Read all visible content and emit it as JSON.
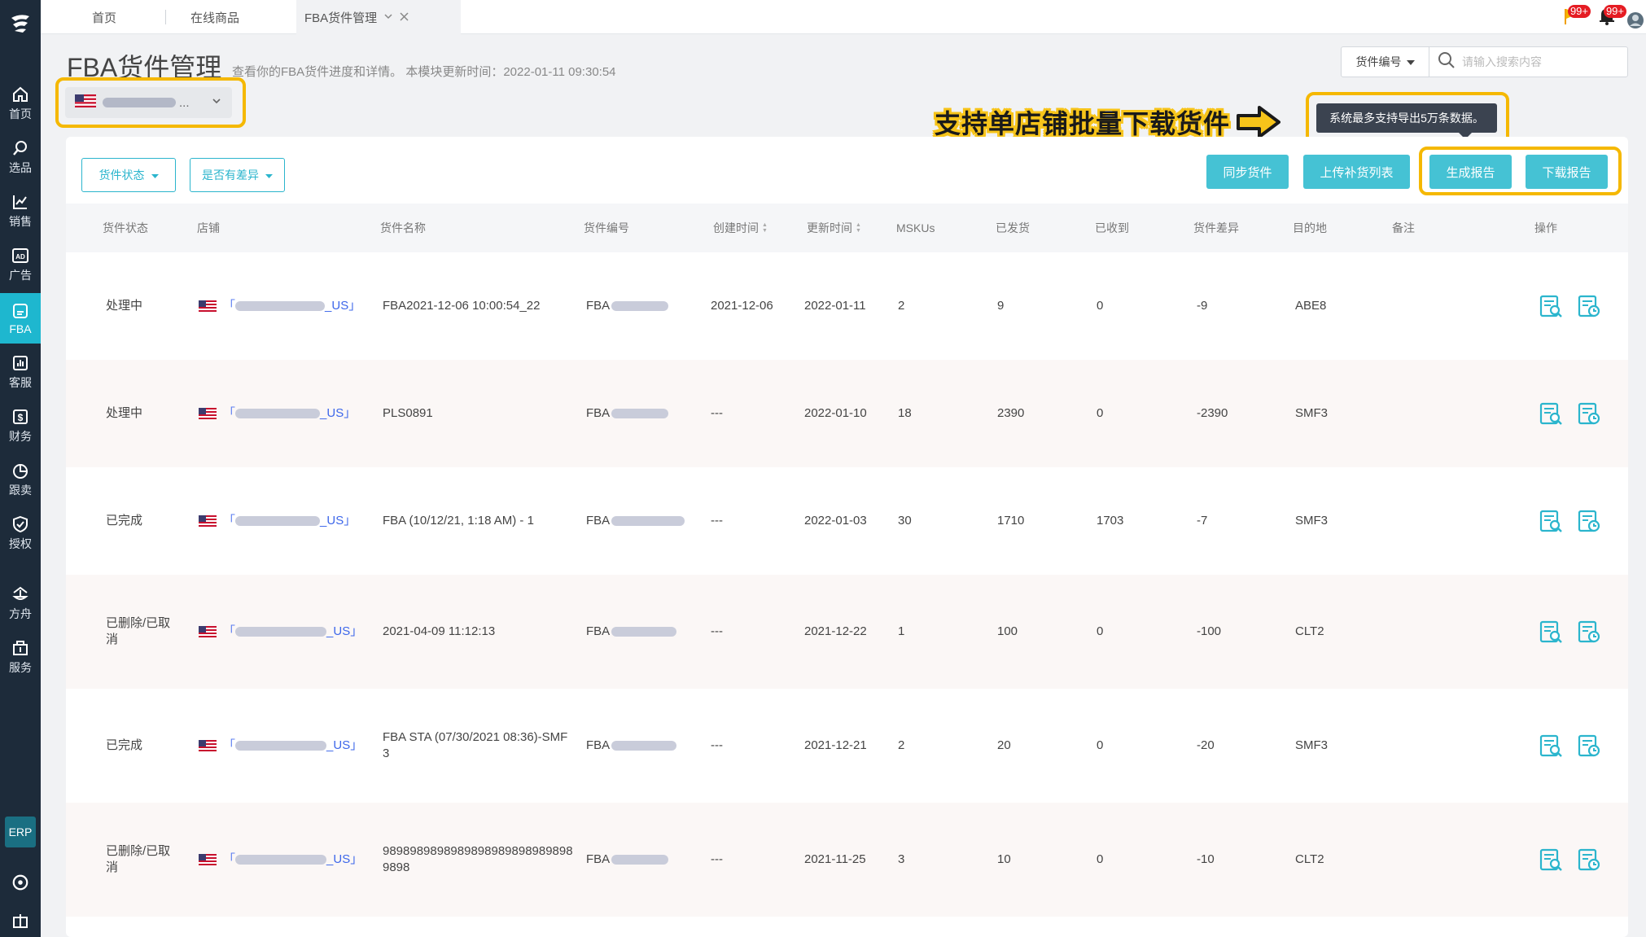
{
  "sidebar": {
    "logo": "logo",
    "items": [
      {
        "label": "首页",
        "icon": "home-icon"
      },
      {
        "label": "选品",
        "icon": "search-icon"
      },
      {
        "label": "销售",
        "icon": "chart-line-icon"
      },
      {
        "label": "广告",
        "icon": "ad-icon"
      },
      {
        "label": "FBA",
        "icon": "fba-box-icon"
      },
      {
        "label": "客服",
        "icon": "service-chart-icon"
      },
      {
        "label": "财务",
        "icon": "dollar-icon"
      },
      {
        "label": "跟卖",
        "icon": "pie-chart-icon"
      },
      {
        "label": "授权",
        "icon": "shield-check-icon"
      },
      {
        "label": "方舟",
        "icon": "ark-icon"
      },
      {
        "label": "服务",
        "icon": "building-icon"
      }
    ],
    "erp": "ERP"
  },
  "tabs": {
    "home": "首页",
    "online": "在线商品",
    "fba": "FBA货件管理"
  },
  "notifications": {
    "flag_badge": "99+",
    "bell_badge": "99+"
  },
  "header": {
    "title": "FBA货件管理",
    "subtitle": "查看你的FBA货件进度和详情。 本模块更新时间：2022-01-11 09:30:54",
    "store_select": "..."
  },
  "search": {
    "type": "货件编号",
    "placeholder": "请输入搜索内容"
  },
  "annotation": {
    "text": "支持单店铺批量下载货件",
    "tooltip": "系统最多支持导出5万条数据。"
  },
  "filters": {
    "status": "货件状态",
    "diff": "是否有差异"
  },
  "actions": {
    "sync": "同步货件",
    "upload": "上传补货列表",
    "generate": "生成报告",
    "download": "下载报告"
  },
  "table": {
    "headers": {
      "status": "货件状态",
      "store": "店铺",
      "name": "货件名称",
      "id": "货件编号",
      "created": "创建时间",
      "updated": "更新时间",
      "mskus": "MSKUs",
      "shipped": "已发货",
      "received": "已收到",
      "diff": "货件差异",
      "dest": "目的地",
      "note": "备注",
      "ops": "操作"
    },
    "rows": [
      {
        "status": "处理中",
        "store_open": "「",
        "store_suffix": "_US」",
        "name": "FBA2021-12-06 10:00:54_22",
        "id_prefix": "FBA",
        "created": "2021-12-06",
        "updated": "2022-01-11",
        "mskus": "2",
        "shipped": "9",
        "received": "0",
        "diff": "-9",
        "dest": "ABE8"
      },
      {
        "status": "处理中",
        "store_open": "「",
        "store_suffix": "_US」",
        "name": "PLS0891",
        "id_prefix": "FBA",
        "created": "---",
        "updated": "2022-01-10",
        "mskus": "18",
        "shipped": "2390",
        "received": "0",
        "diff": "-2390",
        "dest": "SMF3"
      },
      {
        "status": "已完成",
        "store_open": "「",
        "store_suffix": "_US」",
        "name": "FBA (10/12/21, 1:18 AM) - 1",
        "id_prefix": "FBA",
        "created": "---",
        "updated": "2022-01-03",
        "mskus": "30",
        "shipped": "1710",
        "received": "1703",
        "diff": "-7",
        "dest": "SMF3"
      },
      {
        "status": "已删除/已取消",
        "store_open": "「",
        "store_suffix": "_US」",
        "name": "2021-04-09 11:12:13",
        "id_prefix": "FBA",
        "created": "---",
        "updated": "2021-12-22",
        "mskus": "1",
        "shipped": "100",
        "received": "0",
        "diff": "-100",
        "dest": "CLT2"
      },
      {
        "status": "已完成",
        "store_open": "「",
        "store_suffix": "_US」",
        "name": "FBA STA (07/30/2021 08:36)-SMF3",
        "id_prefix": "FBA",
        "created": "---",
        "updated": "2021-12-21",
        "mskus": "2",
        "shipped": "20",
        "received": "0",
        "diff": "-20",
        "dest": "SMF3"
      },
      {
        "status": "已删除/已取消",
        "store_open": "「",
        "store_suffix": "_US」",
        "name": "98989898989898989898989898989898",
        "id_prefix": "FBA",
        "created": "---",
        "updated": "2021-11-25",
        "mskus": "3",
        "shipped": "10",
        "received": "0",
        "diff": "-10",
        "dest": "CLT2"
      }
    ]
  },
  "colors": {
    "accent": "#45c2d4",
    "sidebar": "#1d2b3a",
    "highlight": "#f5b800"
  }
}
